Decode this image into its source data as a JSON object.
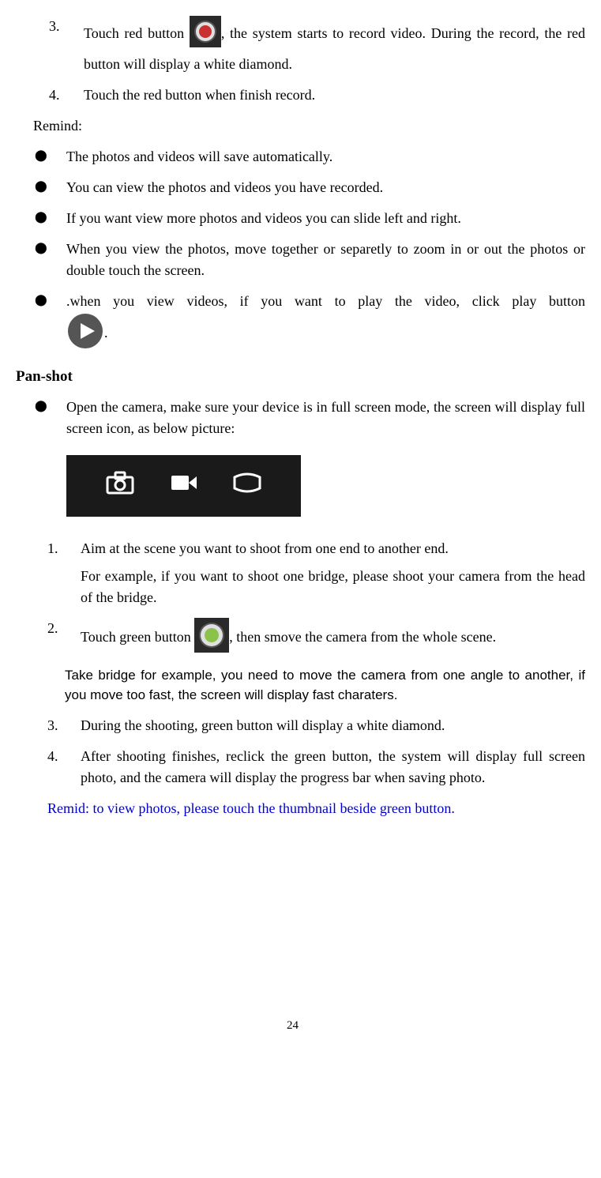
{
  "step3_num": "3.",
  "step3_a": "Touch red button ",
  "step3_b": ", the system starts to record video. During the record, the red button will display a white diamond.",
  "step4_num": "4.",
  "step4": "Touch the red button when finish record.",
  "remind_label": "Remind:",
  "b1": "The photos and videos will save automatically.",
  "b2": "You can view the photos and videos you have recorded.",
  "b3": "If you want view more photos and videos you can slide left and right.",
  "b4": "When you view the photos, move together or separetly to zoom in or out the photos or double touch the screen.",
  "b5_line1": ".when you view videos, if you want to play the video, click play button",
  "b5_period": ".",
  "section_title": "Pan-shot",
  "pan_intro": "Open the camera, make sure your device is in full screen mode, the screen will display full screen icon, as below picture:",
  "p1_num": "1.",
  "p1": "Aim at the scene you want to shoot from one end to another end.",
  "p1_sub": "For example, if you want to shoot one bridge, please shoot your camera from the head of the bridge.",
  "p2_num": "2.",
  "p2_a": "Touch green button ",
  "p2_b": ", then smove the camera from the whole scene.",
  "p2_sans": "Take bridge for example, you need to move the camera from one angle to another, if you move too fast, the screen will display fast charaters.",
  "p3_num": "3.",
  "p3": "During the shooting, green button will display a white diamond.",
  "p4_num": "4.",
  "p4": "After shooting finishes, reclick the green button, the system will display full screen photo, and the camera will display the progress bar when saving photo.",
  "remid_blue": "Remid: to view photos, please touch the thumbnail beside green button.",
  "page_num": "24"
}
